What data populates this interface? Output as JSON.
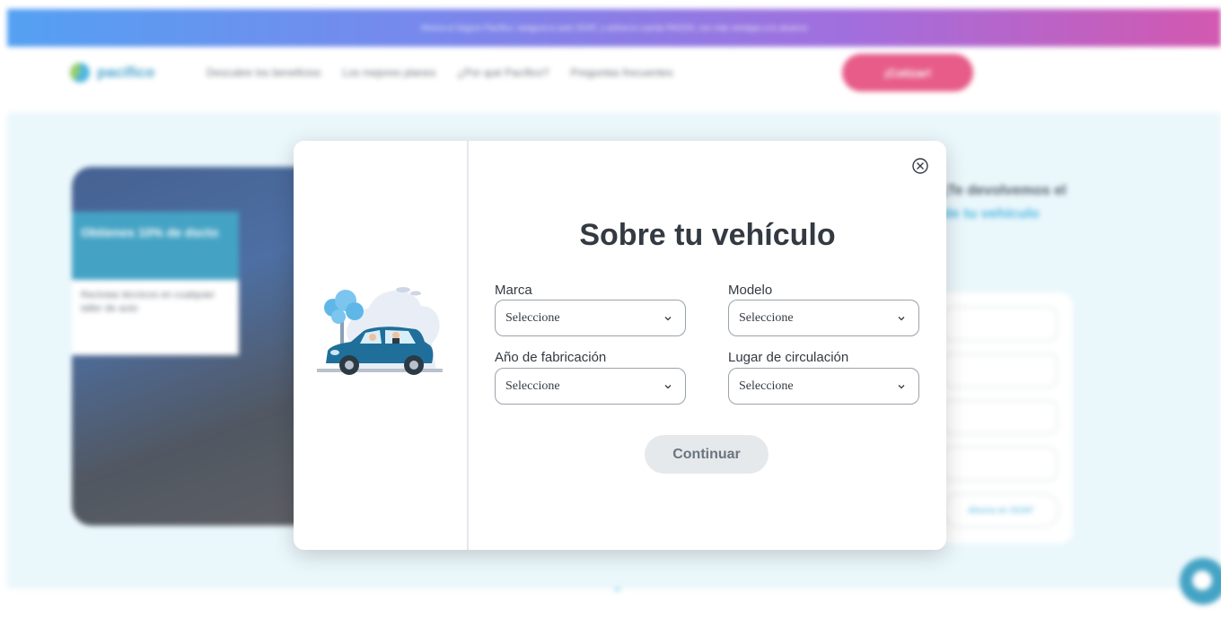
{
  "background": {
    "promo_text": "Ahorra el Seguro Pacífico: asegura tu auto SOAT, y activa tu cuenta PAGOS, con más ventajas a tu alcance",
    "logo_text": "pacífico",
    "nav_links": [
      "Descubre los beneficios",
      "Los mejores planes",
      "¿Por qué Pacífico?",
      "Preguntas frecuentes"
    ],
    "nav_cta": "¡Cotizar!",
    "hero_card_title": "Obtienes 10% de dscto",
    "hero_card_body": "Reclutas técnicos en cualquier taller de auto",
    "right_title_line1": "¡Te devolvemos el",
    "right_title_line2": "de tu vehículo",
    "form_button": "Ahorra en SOAT",
    "scroll_hint": "⌄"
  },
  "modal": {
    "title": "Sobre tu vehículo",
    "fields": [
      {
        "label": "Marca",
        "value": "Seleccione"
      },
      {
        "label": "Modelo",
        "value": "Seleccione"
      },
      {
        "label": "Año de fabricación",
        "value": "Seleccione"
      },
      {
        "label": "Lugar de circulación",
        "value": "Seleccione"
      }
    ],
    "continue_label": "Continuar",
    "close_icon": "close-circle-icon"
  },
  "colors": {
    "accent": "#29a7d9",
    "cta": "#e2396f",
    "button_disabled": "#e6e9ec",
    "car": "#1f6f9a"
  }
}
